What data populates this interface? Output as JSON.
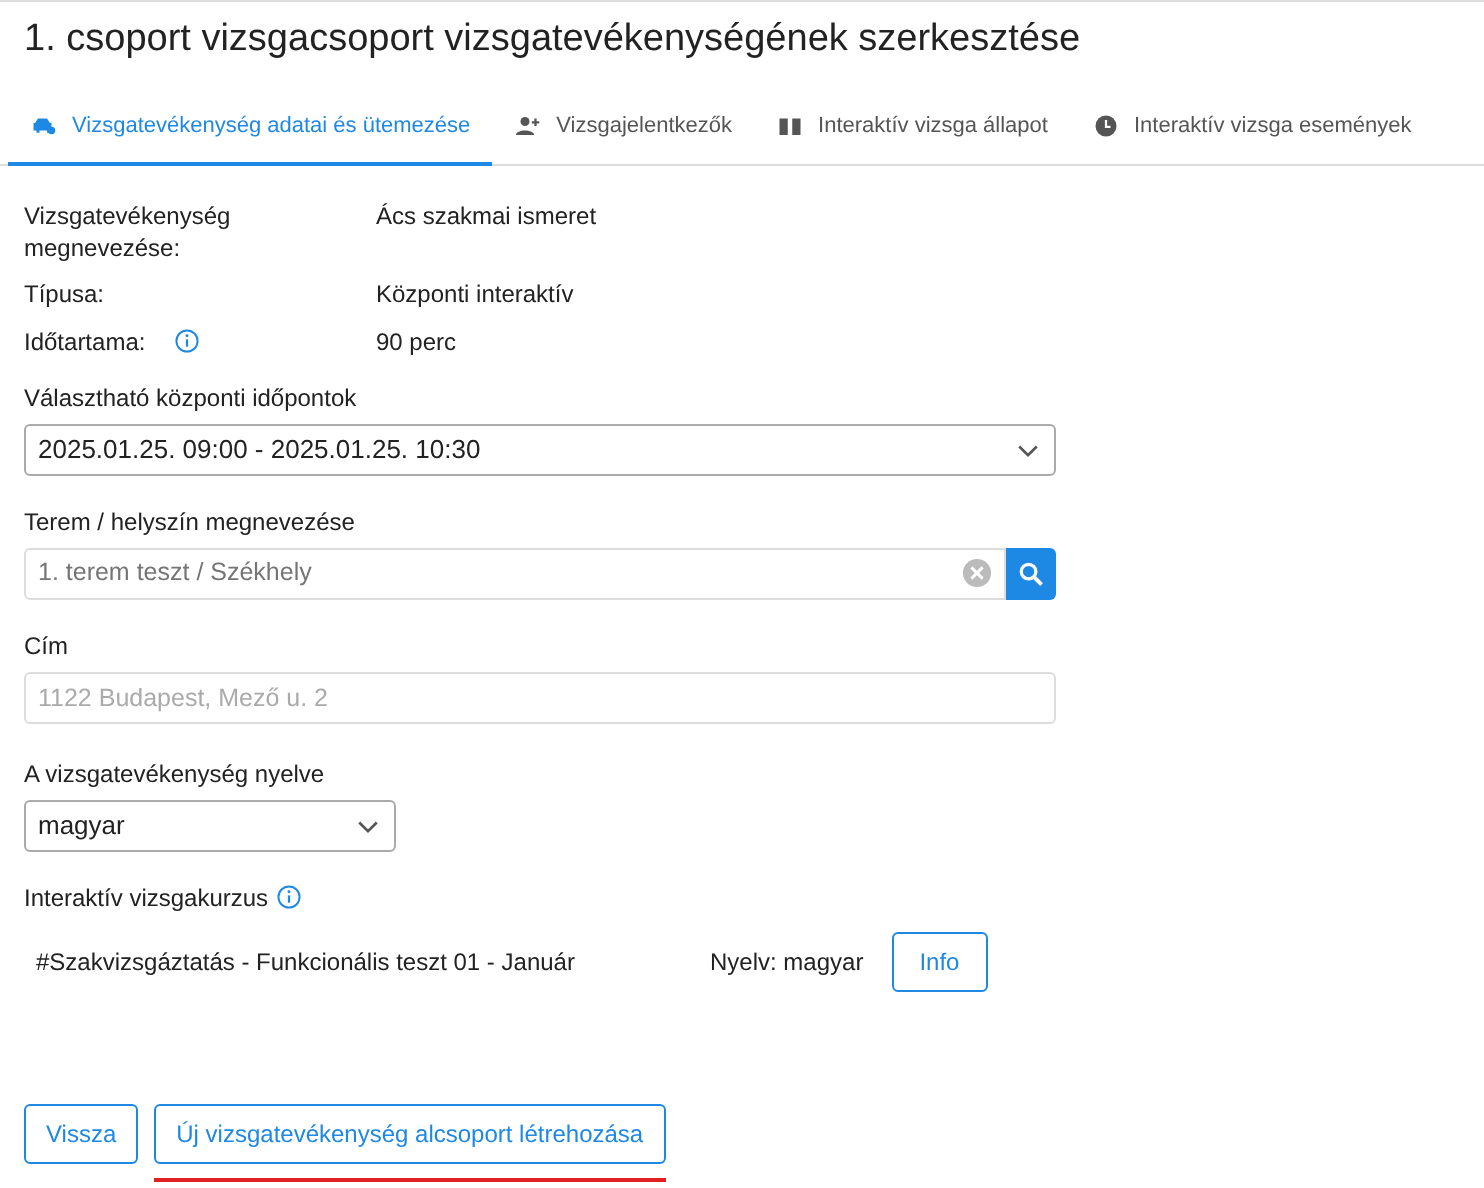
{
  "title": "1. csoport vizsgacsoport vizsgatevékenységének szerkesztése",
  "tabs": [
    {
      "label": "Vizsgatevékenység adatai és ütemezése",
      "selected": true
    },
    {
      "label": "Vizsgajelentkezők",
      "selected": false
    },
    {
      "label": "Interaktív vizsga állapot",
      "selected": false
    },
    {
      "label": "Interaktív vizsga események",
      "selected": false
    }
  ],
  "details": [
    {
      "label": "Vizsgatevékenység megnevezése:",
      "value": "Ács szakmai ismeret",
      "info": false
    },
    {
      "label": "Típusa:",
      "value": "Központi interaktív",
      "info": false
    },
    {
      "label": "Időtartama:",
      "value": "90 perc",
      "info": true
    }
  ],
  "time_select": {
    "label": "Választható központi időpontok",
    "value": "2025.01.25. 09:00 - 2025.01.25. 10:30"
  },
  "location": {
    "label": "Terem / helyszín megnevezése",
    "placeholder": "1. terem teszt / Székhely"
  },
  "address": {
    "label": "Cím",
    "placeholder": "1122 Budapest, Mező u. 2"
  },
  "language_select": {
    "label": "A vizsgatevékenység nyelve",
    "value": "magyar"
  },
  "course": {
    "label": "Interaktív vizsgakurzus",
    "name": "#Szakvizsgáztatás - Funkcionális teszt 01 - Január",
    "language": "Nyelv: magyar",
    "button": "Info"
  },
  "buttons": [
    {
      "label": "Vissza",
      "highlighted": false
    },
    {
      "label": "Új vizsgatevékenység alcsoport létrehozása",
      "highlighted": true
    }
  ]
}
